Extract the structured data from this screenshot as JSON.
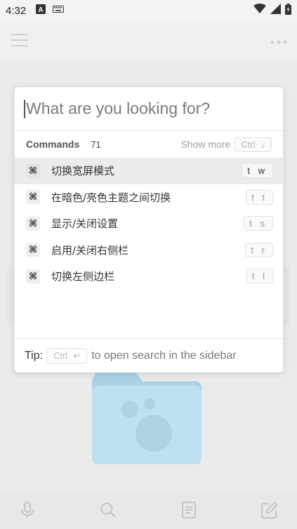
{
  "status_bar": {
    "time": "4:32",
    "icons": [
      "notification-a-icon",
      "keyboard-icon",
      "wifi-icon",
      "signal-icon",
      "battery-icon"
    ]
  },
  "app_bar": {
    "icons": [
      "hamburger-menu-icon",
      "more-options-icon"
    ]
  },
  "search": {
    "placeholder": "What are you looking for?",
    "value": ""
  },
  "commands": {
    "title": "Commands",
    "count": "71",
    "show_more": "Show more",
    "show_more_key": "Ctrl",
    "show_more_arrow": "↓",
    "items": [
      {
        "icon": "⌘",
        "label": "切换宽屏模式",
        "hotkey": "t w",
        "active": true
      },
      {
        "icon": "⌘",
        "label": "在暗色/亮色主题之间切换",
        "hotkey": "t t",
        "active": false
      },
      {
        "icon": "⌘",
        "label": "显示/关闭设置",
        "hotkey": "t s",
        "active": false
      },
      {
        "icon": "⌘",
        "label": "启用/关闭右侧栏",
        "hotkey": "t r",
        "active": false
      },
      {
        "icon": "⌘",
        "label": "切换左侧边栏",
        "hotkey": "t l",
        "active": false
      }
    ]
  },
  "tip": {
    "label": "Tip:",
    "key": "Ctrl",
    "enter_glyph": "↵",
    "text": "to open search in the sidebar"
  },
  "bottom_bar": {
    "icons": [
      "microphone-icon",
      "search-icon",
      "document-icon",
      "edit-icon"
    ]
  },
  "colors": {
    "folder": "#bfe0f0",
    "modal_bg": "#ffffff",
    "active_row": "#ececec"
  }
}
